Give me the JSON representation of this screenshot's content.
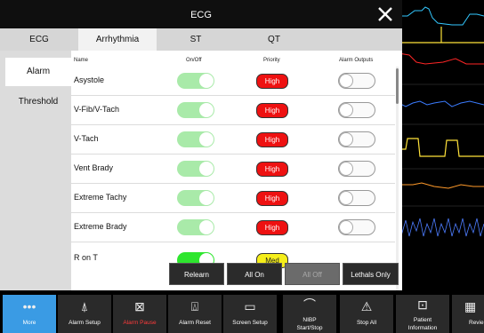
{
  "dialog": {
    "title": "ECG"
  },
  "tabs": [
    {
      "label": "ECG"
    },
    {
      "label": "Arrhythmia"
    },
    {
      "label": "ST"
    },
    {
      "label": "QT"
    }
  ],
  "active_tab": 1,
  "side_nav": [
    {
      "label": "Alarm",
      "active": true
    },
    {
      "label": "Threshold",
      "active": false
    }
  ],
  "table": {
    "headers": {
      "name": "Name",
      "onoff": "On/Off",
      "priority": "Priority",
      "outputs": "Alarm Outputs"
    },
    "rows": [
      {
        "name": "Asystole",
        "on": true,
        "priority": "High",
        "output": false
      },
      {
        "name": "V-Fib/V-Tach",
        "on": true,
        "priority": "High",
        "output": false
      },
      {
        "name": "V-Tach",
        "on": true,
        "priority": "High",
        "output": false
      },
      {
        "name": "Vent Brady",
        "on": true,
        "priority": "High",
        "output": false
      },
      {
        "name": "Extreme Tachy",
        "on": true,
        "priority": "High",
        "output": false
      },
      {
        "name": "Extreme Brady",
        "on": true,
        "priority": "High",
        "output": false
      },
      {
        "name": "R on T",
        "on": true,
        "priority": "Med",
        "output": false
      }
    ]
  },
  "actions": {
    "relearn": "Relearn",
    "all_on": "All On",
    "all_off": "All Off",
    "lethals_only": "Lethals Only"
  },
  "bottom_bar": [
    {
      "label": "More",
      "icon": "more-icon"
    },
    {
      "label": "Alarm Setup",
      "icon": "alarm-setup-icon"
    },
    {
      "label": "Alarm Pause",
      "icon": "alarm-pause-icon"
    },
    {
      "label": "Alarm Reset",
      "icon": "alarm-reset-icon"
    },
    {
      "label": "Screen Setup",
      "icon": "screen-setup-icon"
    },
    {
      "label1": "NIBP",
      "label2": "Start/Stop",
      "icon": "nibp-icon"
    },
    {
      "label": "Stop All",
      "icon": "stop-all-icon"
    },
    {
      "label1": "Patient",
      "label2": "Information",
      "icon": "patient-info-icon"
    },
    {
      "label": "Revie",
      "icon": "review-icon"
    }
  ],
  "colors": {
    "toggle_on": "#a9eaa9",
    "priority_high": "#ee1111",
    "priority_med": "#f5ee1a",
    "more_button": "#3a9be4",
    "alarm_pause_text": "#ff3b3b"
  }
}
